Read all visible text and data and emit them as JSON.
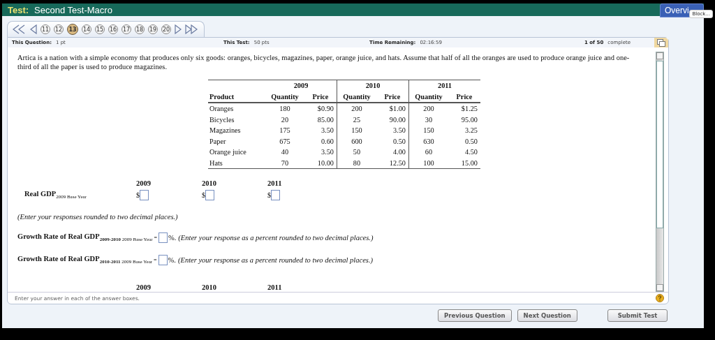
{
  "header": {
    "label": "Test:",
    "title": "Second Test-Macro",
    "overview_button": "Overvi",
    "tooltip": "Block..."
  },
  "question_nav": {
    "items": [
      {
        "kind": "first"
      },
      {
        "kind": "previous"
      },
      {
        "kind": "number",
        "label": "11",
        "selected": false
      },
      {
        "kind": "number",
        "label": "12",
        "selected": false
      },
      {
        "kind": "number",
        "label": "13",
        "selected": true
      },
      {
        "kind": "number",
        "label": "14",
        "selected": false
      },
      {
        "kind": "number",
        "label": "15",
        "selected": false
      },
      {
        "kind": "number",
        "label": "16",
        "selected": false
      },
      {
        "kind": "number",
        "label": "17",
        "selected": false
      },
      {
        "kind": "number",
        "label": "18",
        "selected": false
      },
      {
        "kind": "number",
        "label": "19",
        "selected": false
      },
      {
        "kind": "number",
        "label": "20",
        "selected": false
      },
      {
        "kind": "next"
      },
      {
        "kind": "last"
      }
    ]
  },
  "info_bar": {
    "question_label": "This Question:",
    "question_value": "1 pt",
    "test_label": "This Test:",
    "test_value": "50 pts",
    "time_label": "Time Remaining:",
    "time_value": "02:16:59",
    "progress": "1 of 50",
    "progress_label": "complete"
  },
  "question": {
    "text": "Artica is a nation with a simple economy that produces only six goods: oranges, bicycles, magazines, paper, orange juice, and hats. Assume that half of all the oranges are used to produce orange juice and one-third of all the paper is used to produce magazines.",
    "table": {
      "years": [
        "2009",
        "2010",
        "2011"
      ],
      "columns": [
        "Product",
        "Quantity",
        "Price",
        "Quantity",
        "Price",
        "Quantity",
        "Price"
      ],
      "rows": [
        [
          "Oranges",
          "180",
          "$0.90",
          "200",
          "$1.00",
          "200",
          "$1.25"
        ],
        [
          "Bicycles",
          "20",
          "85.00",
          "25",
          "90.00",
          "30",
          "95.00"
        ],
        [
          "Magazines",
          "175",
          "3.50",
          "150",
          "3.50",
          "150",
          "3.25"
        ],
        [
          "Paper",
          "675",
          "0.60",
          "600",
          "0.50",
          "630",
          "0.50"
        ],
        [
          "Orange juice",
          "40",
          "3.50",
          "50",
          "4.00",
          "60",
          "4.50"
        ],
        [
          "Hats",
          "70",
          "10.00",
          "80",
          "12.50",
          "100",
          "15.00"
        ]
      ]
    },
    "real_gdp": {
      "years": [
        "2009",
        "2010",
        "2011"
      ],
      "label": "Real GDP",
      "base": "2009 Base Year",
      "currency": [
        "$",
        "$",
        "$"
      ]
    },
    "note": "(Enter your responses rounded to two decimal places.)",
    "growth_rates": [
      {
        "label": "Growth Rate of Real GDP",
        "period": "2009-2010",
        "base": "2009 Base Year",
        "equals": "=",
        "unit": "%.",
        "instruction": "(Enter your response as a percent rounded to two decimal places.)"
      },
      {
        "label": "Growth Rate of Real GDP",
        "period": "2010-2011",
        "base": "2009 Base Year",
        "equals": "=",
        "unit": "%.",
        "instruction": "(Enter your response as a percent rounded to two decimal places.)"
      }
    ],
    "next_years": [
      "2009",
      "2010",
      "2011"
    ]
  },
  "hint": "Enter your answer in each of the answer boxes.",
  "buttons": [
    {
      "label": "Previous Question",
      "kind": "nav"
    },
    {
      "label": "Next Question",
      "kind": "nav"
    },
    {
      "label": "Submit Test",
      "kind": "submit"
    }
  ]
}
